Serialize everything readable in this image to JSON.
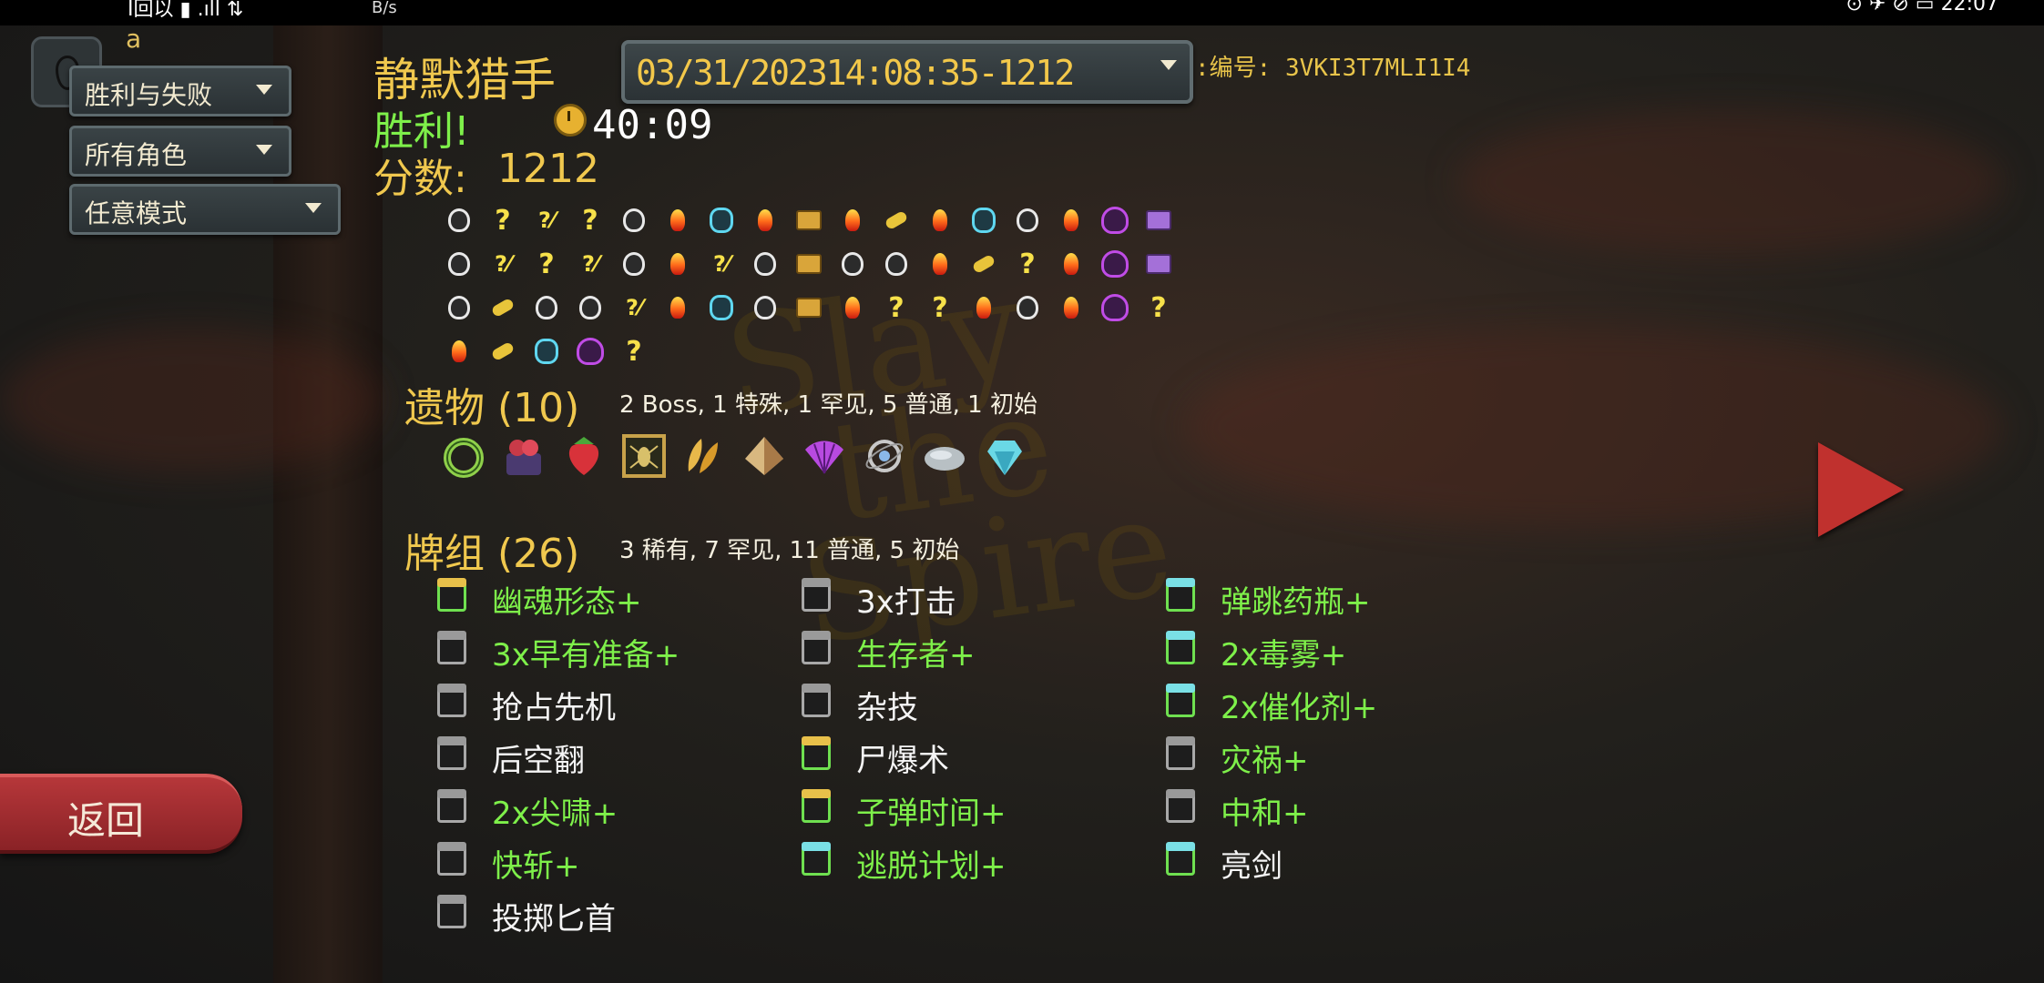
{
  "status_bar": {
    "left": "ꟾ回以 ▮ .ıll ⇅",
    "net": "B/s",
    "right": "⊙ ✈ ⊘ ▭ 22:07"
  },
  "top_left": {
    "letter": "a"
  },
  "filters": {
    "result": {
      "selected": "胜利与失败"
    },
    "character": {
      "selected": "所有角色"
    },
    "mode": {
      "selected": "任意模式"
    }
  },
  "run": {
    "selected": "03/31/202314:08:35-1212",
    "seed_label": ":编号: 3VKI3T7MLI1I4",
    "character": "静默猎手",
    "result": "胜利!",
    "time": "40:09",
    "score_label": "分数:",
    "score": "1212"
  },
  "path_rows": [
    [
      "m",
      "q",
      "qm",
      "q",
      "m",
      "r",
      "e",
      "r",
      "t",
      "r",
      "s",
      "r",
      "e",
      "m",
      "r",
      "b",
      "u"
    ],
    [
      "m",
      "qm",
      "q",
      "qm",
      "m",
      "r",
      "qm",
      "m",
      "t",
      "m",
      "m",
      "r",
      "s",
      "q",
      "r",
      "b",
      "u"
    ],
    [
      "m",
      "s",
      "m",
      "m",
      "qm",
      "r",
      "e",
      "m",
      "t",
      "r",
      "q",
      "q",
      "r",
      "m",
      "r",
      "b",
      "q"
    ],
    [
      "r",
      "s",
      "e",
      "b",
      "q"
    ]
  ],
  "relics": {
    "title": "遗物 (10)",
    "summary": "2  Boss, 1  特殊, 1  罕见, 5  普通, 1  初始",
    "items": [
      "ring-of-snake",
      "mummified-hand",
      "strawberry",
      "insect-frame",
      "golden-petals",
      "pyramid",
      "fan",
      "orbital",
      "stone",
      "gem"
    ]
  },
  "deck": {
    "title": "牌组 (26)",
    "summary": "3  稀有, 7  罕见, 11  普通, 5  初始",
    "columns": [
      [
        {
          "name": "幽魂形态+",
          "upgraded": true,
          "band": "gold"
        },
        {
          "name": "3x早有准备+",
          "upgraded": true,
          "band": "gray"
        },
        {
          "name": "抢占先机",
          "upgraded": false,
          "band": "gray"
        },
        {
          "name": "后空翻",
          "upgraded": false,
          "band": "gray"
        },
        {
          "name": "2x尖啸+",
          "upgraded": true,
          "band": "gray"
        },
        {
          "name": "快斩+",
          "upgraded": true,
          "band": "gray"
        },
        {
          "name": "投掷匕首",
          "upgraded": false,
          "band": "gray"
        }
      ],
      [
        {
          "name": "3x打击",
          "upgraded": false,
          "band": "gray"
        },
        {
          "name": "生存者+",
          "upgraded": true,
          "band": "gray"
        },
        {
          "name": "杂技",
          "upgraded": false,
          "band": "gray"
        },
        {
          "name": "尸爆术",
          "upgraded": false,
          "band": "gold"
        },
        {
          "name": "子弹时间+",
          "upgraded": true,
          "band": "gold"
        },
        {
          "name": "逃脱计划+",
          "upgraded": true,
          "band": "cyan"
        }
      ],
      [
        {
          "name": "弹跳药瓶+",
          "upgraded": true,
          "band": "cyan"
        },
        {
          "name": "2x毒雾+",
          "upgraded": true,
          "band": "cyan"
        },
        {
          "name": "2x催化剂+",
          "upgraded": true,
          "band": "cyan"
        },
        {
          "name": "灾祸+",
          "upgraded": true,
          "band": "gray"
        },
        {
          "name": "中和+",
          "upgraded": true,
          "band": "gray"
        },
        {
          "name": "亮剑",
          "upgraded": false,
          "band": "cyan"
        }
      ]
    ]
  },
  "back_button": {
    "label": "返回"
  },
  "watermark": "Slay the Spire",
  "colors": {
    "accent_gold": "#f0c84e",
    "upgraded_green": "#7ef04a",
    "back_red": "#b6373a"
  }
}
